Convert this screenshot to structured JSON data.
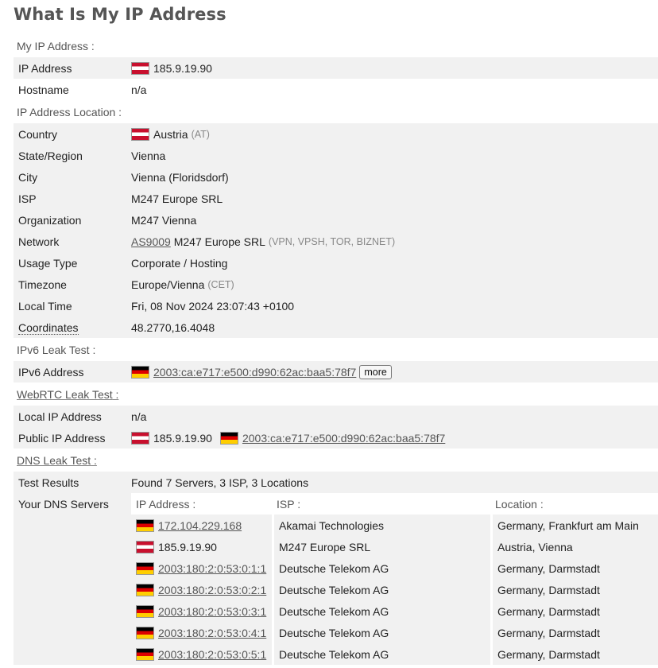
{
  "title": "What Is My IP Address",
  "colors": {
    "row_alt": "#f1f1f1",
    "heading": "#555555"
  },
  "my_ip": {
    "section": "My IP Address :",
    "ip_label": "IP Address",
    "ip_value": "185.9.19.90",
    "ip_flag": "flag-austria-icon",
    "hostname_label": "Hostname",
    "hostname_value": "n/a"
  },
  "location": {
    "section": "IP Address Location :",
    "country_label": "Country",
    "country_value": "Austria",
    "country_code": "(AT)",
    "state_label": "State/Region",
    "state_value": "Vienna",
    "city_label": "City",
    "city_value": "Vienna (Floridsdorf)",
    "isp_label": "ISP",
    "isp_value": "M247 Europe SRL",
    "org_label": "Organization",
    "org_value": "M247 Vienna",
    "network_label": "Network",
    "network_as": "AS9009",
    "network_name": "M247 Europe SRL",
    "network_tags": "(VPN, VPSH, TOR, BIZNET)",
    "usage_label": "Usage Type",
    "usage_value": "Corporate / Hosting",
    "tz_label": "Timezone",
    "tz_value": "Europe/Vienna",
    "tz_abbr": "(CET)",
    "localtime_label": "Local Time",
    "localtime_value": "Fri, 08 Nov 2024 23:07:43 +0100",
    "coords_label": "Coordinates",
    "coords_value": "48.2770,16.4048"
  },
  "ipv6": {
    "section": "IPv6 Leak Test :",
    "label": "IPv6 Address",
    "value": "2003:ca:e717:e500:d990:62ac:baa5:78f7",
    "more_label": "more"
  },
  "webrtc": {
    "section": "WebRTC Leak Test",
    "section_suffix": " :",
    "local_label": "Local IP Address",
    "local_value": "n/a",
    "public_label": "Public IP Address",
    "public_ipv4": "185.9.19.90",
    "public_ipv6": "2003:ca:e717:e500:d990:62ac:baa5:78f7"
  },
  "dns": {
    "section": "DNS Leak Test",
    "section_suffix": " :",
    "results_label": "Test Results",
    "results_value": "Found 7 Servers, 3 ISP, 3 Locations",
    "servers_label": "Your DNS Servers",
    "col_ip": "IP Address :",
    "col_isp": "ISP :",
    "col_location": "Location :",
    "rows": [
      {
        "ip": "172.104.229.168",
        "isp": "Akamai Technologies",
        "location": "Germany, Frankfurt am Main",
        "flag": "de"
      },
      {
        "ip": "185.9.19.90",
        "isp": "M247 Europe SRL",
        "location": "Austria, Vienna",
        "flag": "at"
      },
      {
        "ip": "2003:180:2:0:53:0:1:1",
        "isp": "Deutsche Telekom AG",
        "location": "Germany, Darmstadt",
        "flag": "de"
      },
      {
        "ip": "2003:180:2:0:53:0:2:1",
        "isp": "Deutsche Telekom AG",
        "location": "Germany, Darmstadt",
        "flag": "de"
      },
      {
        "ip": "2003:180:2:0:53:0:3:1",
        "isp": "Deutsche Telekom AG",
        "location": "Germany, Darmstadt",
        "flag": "de"
      },
      {
        "ip": "2003:180:2:0:53:0:4:1",
        "isp": "Deutsche Telekom AG",
        "location": "Germany, Darmstadt",
        "flag": "de"
      },
      {
        "ip": "2003:180:2:0:53:0:5:1",
        "isp": "Deutsche Telekom AG",
        "location": "Germany, Darmstadt",
        "flag": "de"
      }
    ]
  }
}
